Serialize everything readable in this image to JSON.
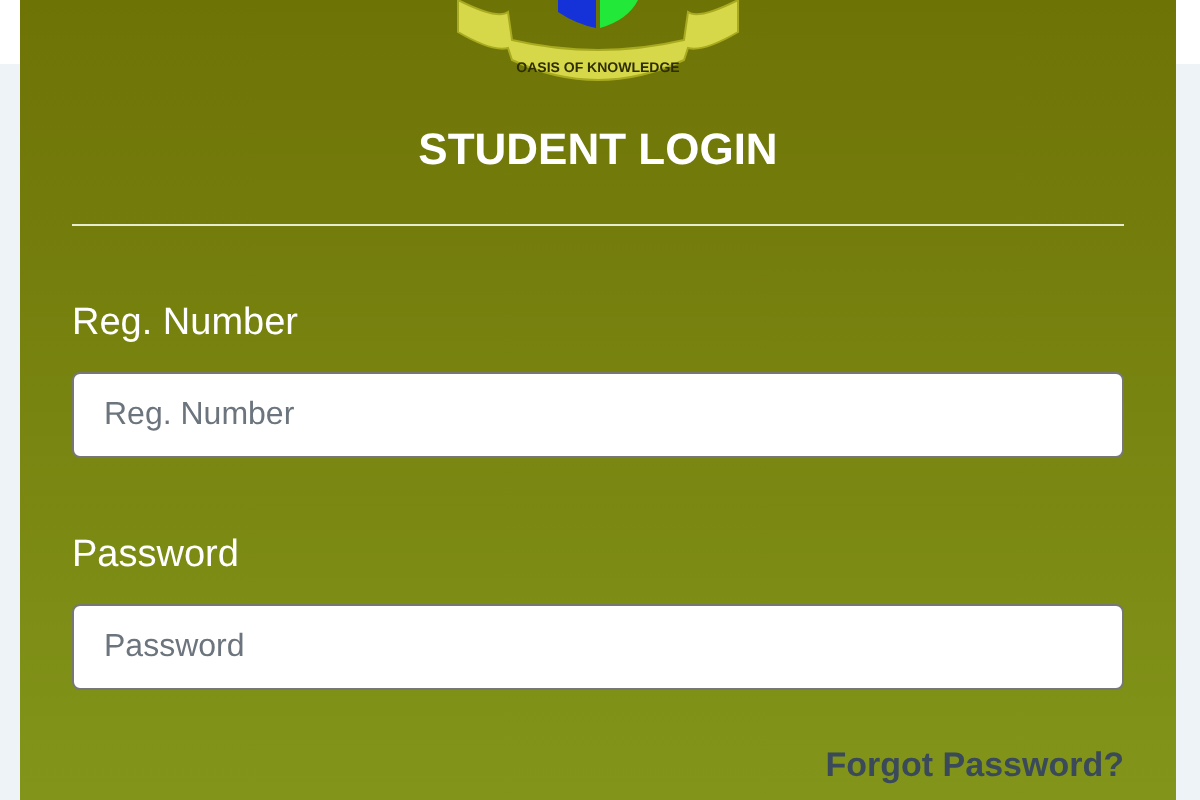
{
  "logo": {
    "motto": "OASIS OF KNOWLEDGE"
  },
  "title": "STUDENT LOGIN",
  "fields": [
    {
      "label": "Reg. Number",
      "placeholder": "Reg. Number"
    },
    {
      "label": "Password",
      "placeholder": "Password"
    }
  ],
  "forgot_link": "Forgot Password?"
}
